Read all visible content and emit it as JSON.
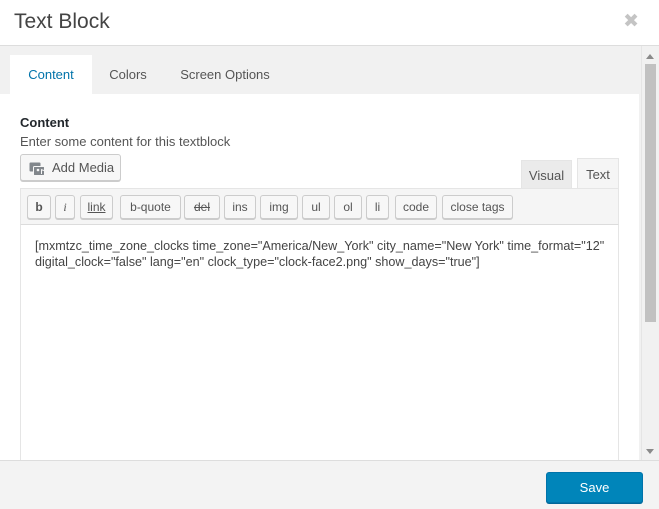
{
  "dialog": {
    "title": "Text Block",
    "close_glyph": "✖"
  },
  "tabs": [
    {
      "label": "Content",
      "active": true
    },
    {
      "label": "Colors",
      "active": false
    },
    {
      "label": "Screen Options",
      "active": false
    }
  ],
  "content": {
    "section_label": "Content",
    "description": "Enter some content for this textblock",
    "add_media_label": "Add Media",
    "add_media_icon": "media-icon",
    "mode_tabs": {
      "visual": "Visual",
      "text": "Text"
    },
    "toolbar_buttons": [
      "b",
      "i",
      "link",
      "b-quote",
      "del",
      "ins",
      "img",
      "ul",
      "ol",
      "li",
      "code",
      "close tags"
    ],
    "editor_text": "[mxmtzc_time_zone_clocks time_zone=\"America/New_York\" city_name=\"New York\" time_format=\"12\" digital_clock=\"false\" lang=\"en\" clock_type=\"clock-face2.png\" show_days=\"true\"]"
  },
  "footer": {
    "save_label": "Save"
  },
  "colors": {
    "accent": "#0073aa",
    "primary_button": "#0085ba"
  }
}
